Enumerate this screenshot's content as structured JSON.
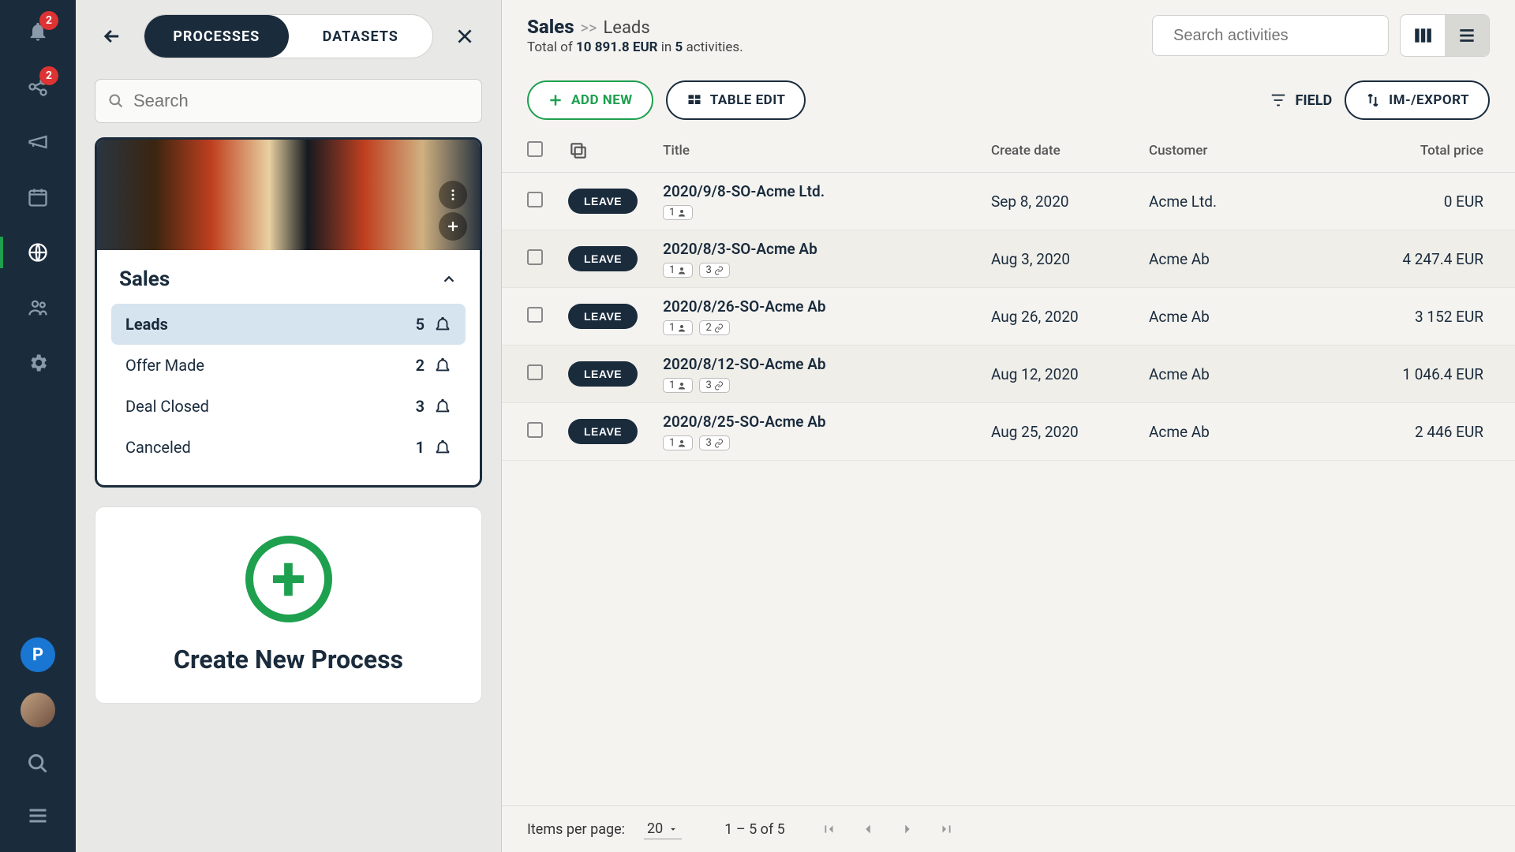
{
  "nav": {
    "notifications_badge": "2",
    "workspace_badge": "2",
    "avatar_letter": "P"
  },
  "tabs": {
    "processes": "PROCESSES",
    "datasets": "DATASETS"
  },
  "side_search_placeholder": "Search",
  "process": {
    "name": "Sales",
    "stages": [
      {
        "name": "Leads",
        "count": "5",
        "active": true
      },
      {
        "name": "Offer Made",
        "count": "2",
        "active": false
      },
      {
        "name": "Deal Closed",
        "count": "3",
        "active": false
      },
      {
        "name": "Canceled",
        "count": "1",
        "active": false
      }
    ]
  },
  "create_label": "Create New Process",
  "breadcrumb": {
    "main": "Sales",
    "sep": ">>",
    "sub": "Leads"
  },
  "total_line": {
    "prefix": "Total of ",
    "amount": "10 891.8 EUR",
    "mid": " in ",
    "count": "5",
    "suffix": " activities."
  },
  "search_activities_placeholder": "Search activities",
  "buttons": {
    "add_new": "ADD NEW",
    "table_edit": "TABLE EDIT",
    "field": "FIELD",
    "import_export": "IM-/EXPORT",
    "leave": "LEAVE"
  },
  "columns": {
    "title": "Title",
    "create_date": "Create date",
    "customer": "Customer",
    "total_price": "Total price"
  },
  "rows": [
    {
      "title": "2020/9/8-SO-Acme Ltd.",
      "users": "1",
      "links": "",
      "date": "Sep 8, 2020",
      "customer": "Acme Ltd.",
      "price": "0 EUR"
    },
    {
      "title": "2020/8/3-SO-Acme Ab",
      "users": "1",
      "links": "3",
      "date": "Aug 3, 2020",
      "customer": "Acme Ab",
      "price": "4 247.4 EUR"
    },
    {
      "title": "2020/8/26-SO-Acme Ab",
      "users": "1",
      "links": "2",
      "date": "Aug 26, 2020",
      "customer": "Acme Ab",
      "price": "3 152 EUR"
    },
    {
      "title": "2020/8/12-SO-Acme Ab",
      "users": "1",
      "links": "3",
      "date": "Aug 12, 2020",
      "customer": "Acme Ab",
      "price": "1 046.4 EUR"
    },
    {
      "title": "2020/8/25-SO-Acme Ab",
      "users": "1",
      "links": "3",
      "date": "Aug 25, 2020",
      "customer": "Acme Ab",
      "price": "2 446 EUR"
    }
  ],
  "paginator": {
    "label": "Items per page:",
    "per_page": "20",
    "range": "1 – 5 of 5"
  }
}
